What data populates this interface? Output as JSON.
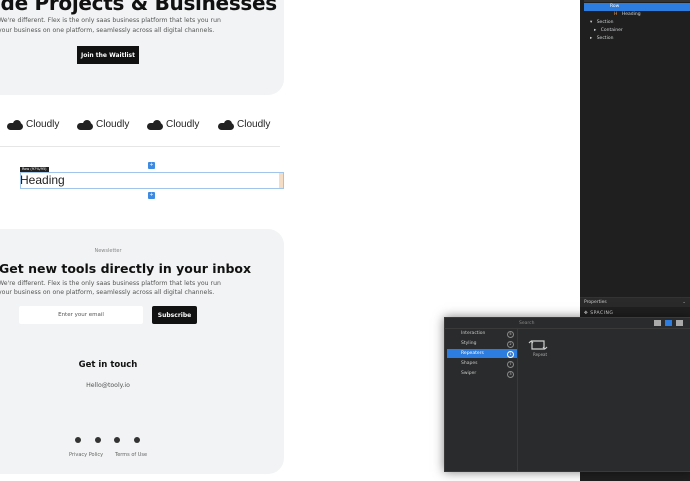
{
  "hero": {
    "title": "ide Projects & Businesses",
    "desc1": "We're different. Flex is the only saas business platform that lets you run",
    "desc2": "your business on one platform, seamlessly across all digital channels.",
    "cta": "Join the Waitlist"
  },
  "logos": [
    "Cloudly",
    "Cloudly",
    "Cloudly",
    "Cloudly"
  ],
  "heading_block": {
    "tag": "Row (97%/95)",
    "text": "Heading"
  },
  "newsletter": {
    "eyebrow": "Newsletter",
    "title": "Get new tools directly in your inbox",
    "desc1": "We're different. Flex is the only saas business platform that lets you run",
    "desc2": "your business on one platform, seamlessly across all digital channels.",
    "email_placeholder": "Enter your email",
    "subscribe": "Subscribe"
  },
  "contact": {
    "title": "Get in touch",
    "email": "Hello@tooly.io"
  },
  "footer": {
    "privacy": "Privacy Policy",
    "terms": "Terms of Use"
  },
  "layers": {
    "row": "Row",
    "heading": "Heading",
    "section1": "Section",
    "container": "Container",
    "section2": "Section"
  },
  "properties": {
    "title": "Properties",
    "spacing": "SPACING"
  },
  "add_panel": {
    "search_placeholder": "Search",
    "categories": [
      {
        "label": "Interaction",
        "count": "5"
      },
      {
        "label": "Styling",
        "count": "2"
      },
      {
        "label": "Repeaters",
        "count": "1"
      },
      {
        "label": "Shapes",
        "count": "7"
      },
      {
        "label": "Swiper",
        "count": "3"
      }
    ],
    "item_label": "Repeat"
  },
  "colors": {
    "accent": "#2d7de0",
    "dark": "#111111",
    "card": "#f1f3f4",
    "panel": "#1f1f1f"
  }
}
